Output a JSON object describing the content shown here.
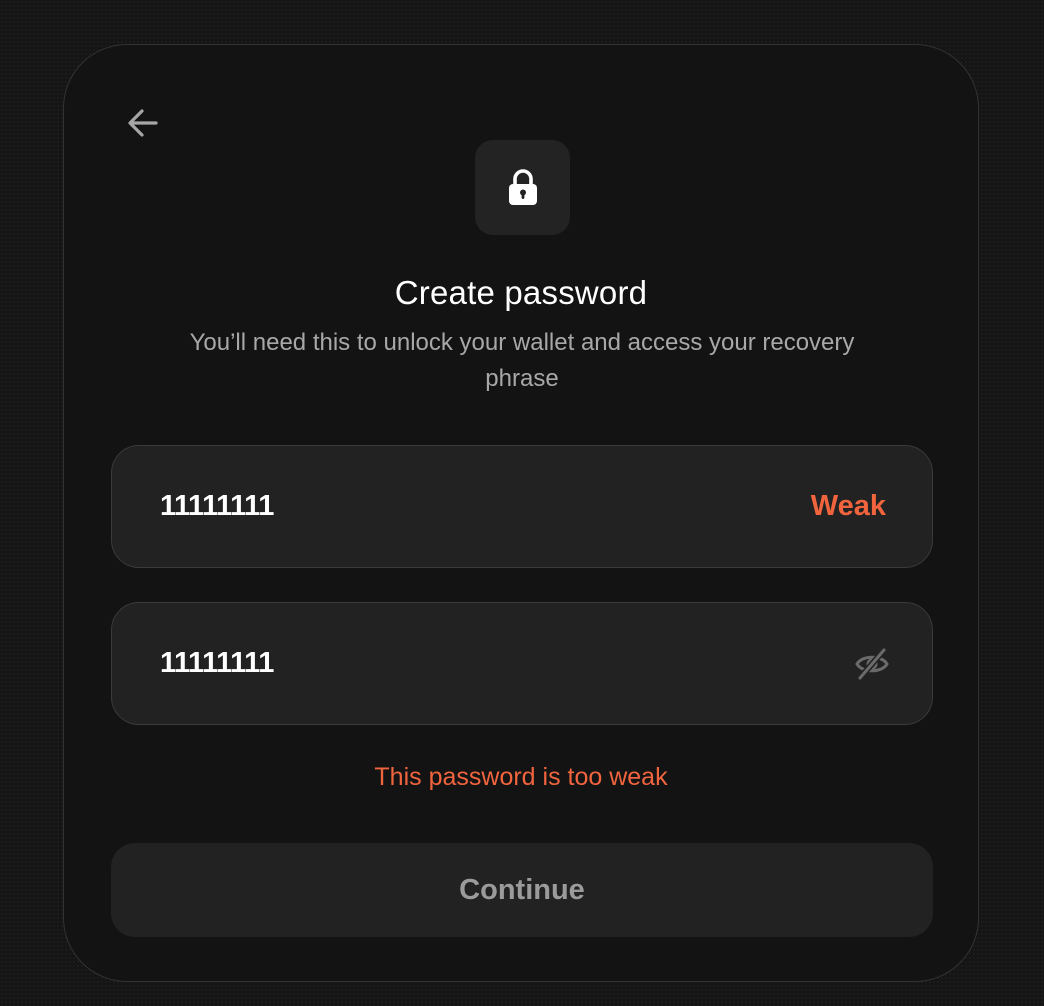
{
  "header": {
    "back_icon": "arrow-left-icon",
    "lock_icon": "lock-icon"
  },
  "content": {
    "title": "Create password",
    "subtitle": "You’ll need this to unlock your wallet and access your recovery phrase"
  },
  "password_field": {
    "value": "11111111",
    "strength": "Weak"
  },
  "confirm_field": {
    "value": "11111111",
    "visibility_icon": "eye-off-icon"
  },
  "error": {
    "message": "This password is too weak"
  },
  "actions": {
    "continue_label": "Continue",
    "continue_enabled": false
  },
  "colors": {
    "background": "#151515",
    "card": "#131313",
    "field": "#222222",
    "error": "#f0643e",
    "text": "#ffffff",
    "muted": "#a8a8a8"
  }
}
